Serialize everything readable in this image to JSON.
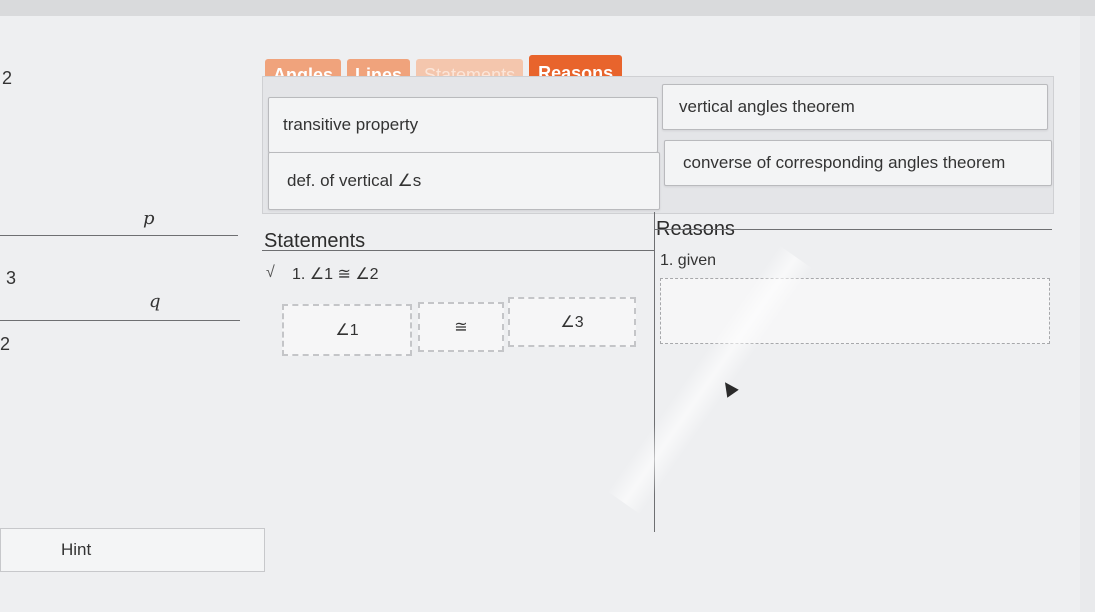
{
  "left_numbers": {
    "top": "2",
    "middle": "3",
    "bottom": "2"
  },
  "diagram": {
    "line_p": "p",
    "line_q": "q"
  },
  "tabs": [
    {
      "label": "Angles",
      "state": "normal"
    },
    {
      "label": "Lines",
      "state": "normal"
    },
    {
      "label": "Statements",
      "state": "disabled"
    },
    {
      "label": "Reasons",
      "state": "active"
    }
  ],
  "reason_chips": [
    "transitive property",
    "vertical angles theorem",
    "def. of vertical ∠s",
    "converse of corresponding angles theorem"
  ],
  "proof": {
    "statements_header": "Statements",
    "reasons_header": "Reasons",
    "row1": {
      "check": "√",
      "statement": "1. ∠1 ≅ ∠2",
      "reason": "1. given"
    },
    "row2": {
      "slot1": "∠1",
      "slot2": "≅",
      "slot3": "∠3",
      "reason_slot": ""
    }
  },
  "hint_label": "Hint",
  "colors": {
    "accent": "#e8642c",
    "tab_normal": "#f0a37c",
    "tab_disabled": "#f4c6ad"
  }
}
